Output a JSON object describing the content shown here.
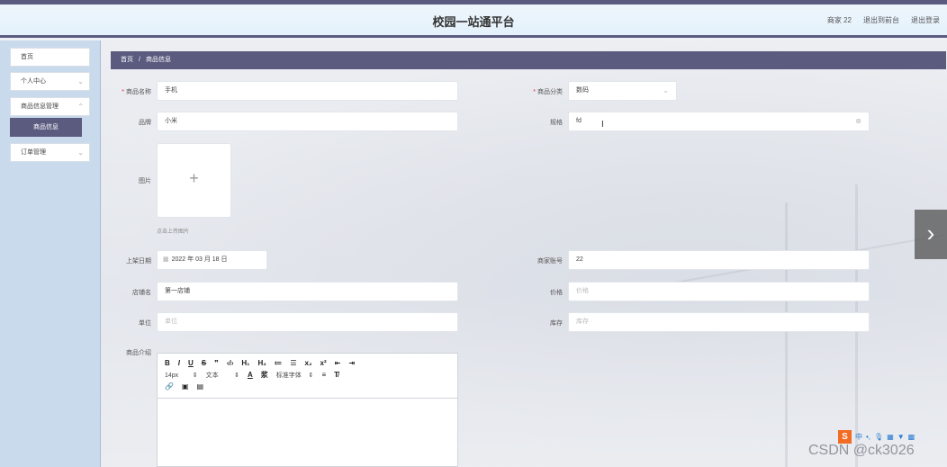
{
  "header": {
    "title": "校园一站通平台",
    "user": "商家 22",
    "back_to_frontend": "退出到前台",
    "logout": "退出登录"
  },
  "sidebar": {
    "items": [
      {
        "label": "首页"
      },
      {
        "label": "个人中心"
      },
      {
        "label": "商品信息管理"
      },
      {
        "label": "商品信息"
      },
      {
        "label": "订单管理"
      }
    ]
  },
  "breadcrumb": {
    "home": "首页",
    "separator": "/",
    "current": "商品信息"
  },
  "form": {
    "name": {
      "label": "商品名称",
      "value": "手机"
    },
    "category": {
      "label": "商品分类",
      "value": "数码"
    },
    "brand": {
      "label": "品牌",
      "value": "小米"
    },
    "spec": {
      "label": "规格",
      "value": "fd"
    },
    "image": {
      "label": "图片",
      "tip": "点击上传图片"
    },
    "date": {
      "label": "上架日期",
      "value": "2022 年 03 月 18 日"
    },
    "merchant": {
      "label": "商家账号",
      "value": "22"
    },
    "shop": {
      "label": "店铺名",
      "value": "第一店铺"
    },
    "price": {
      "label": "价格",
      "placeholder": "价格"
    },
    "unit": {
      "label": "单位",
      "placeholder": "单位"
    },
    "stock": {
      "label": "库存",
      "placeholder": "库存"
    },
    "intro": {
      "label": "商品介绍"
    }
  },
  "editor": {
    "row1": [
      "B",
      "I",
      "U",
      "S",
      "❞",
      "‹/›",
      "H₁",
      "H₂",
      "≔",
      "☰",
      "x₂",
      "x²",
      "⇤",
      "⇥"
    ],
    "font_size": "14px",
    "paragraph": "文本",
    "font_family": "标准字体",
    "row3_icons": [
      "link-icon",
      "image-icon",
      "video-icon"
    ]
  },
  "watermark": "CSDN @ck3026",
  "ime_label": "中"
}
